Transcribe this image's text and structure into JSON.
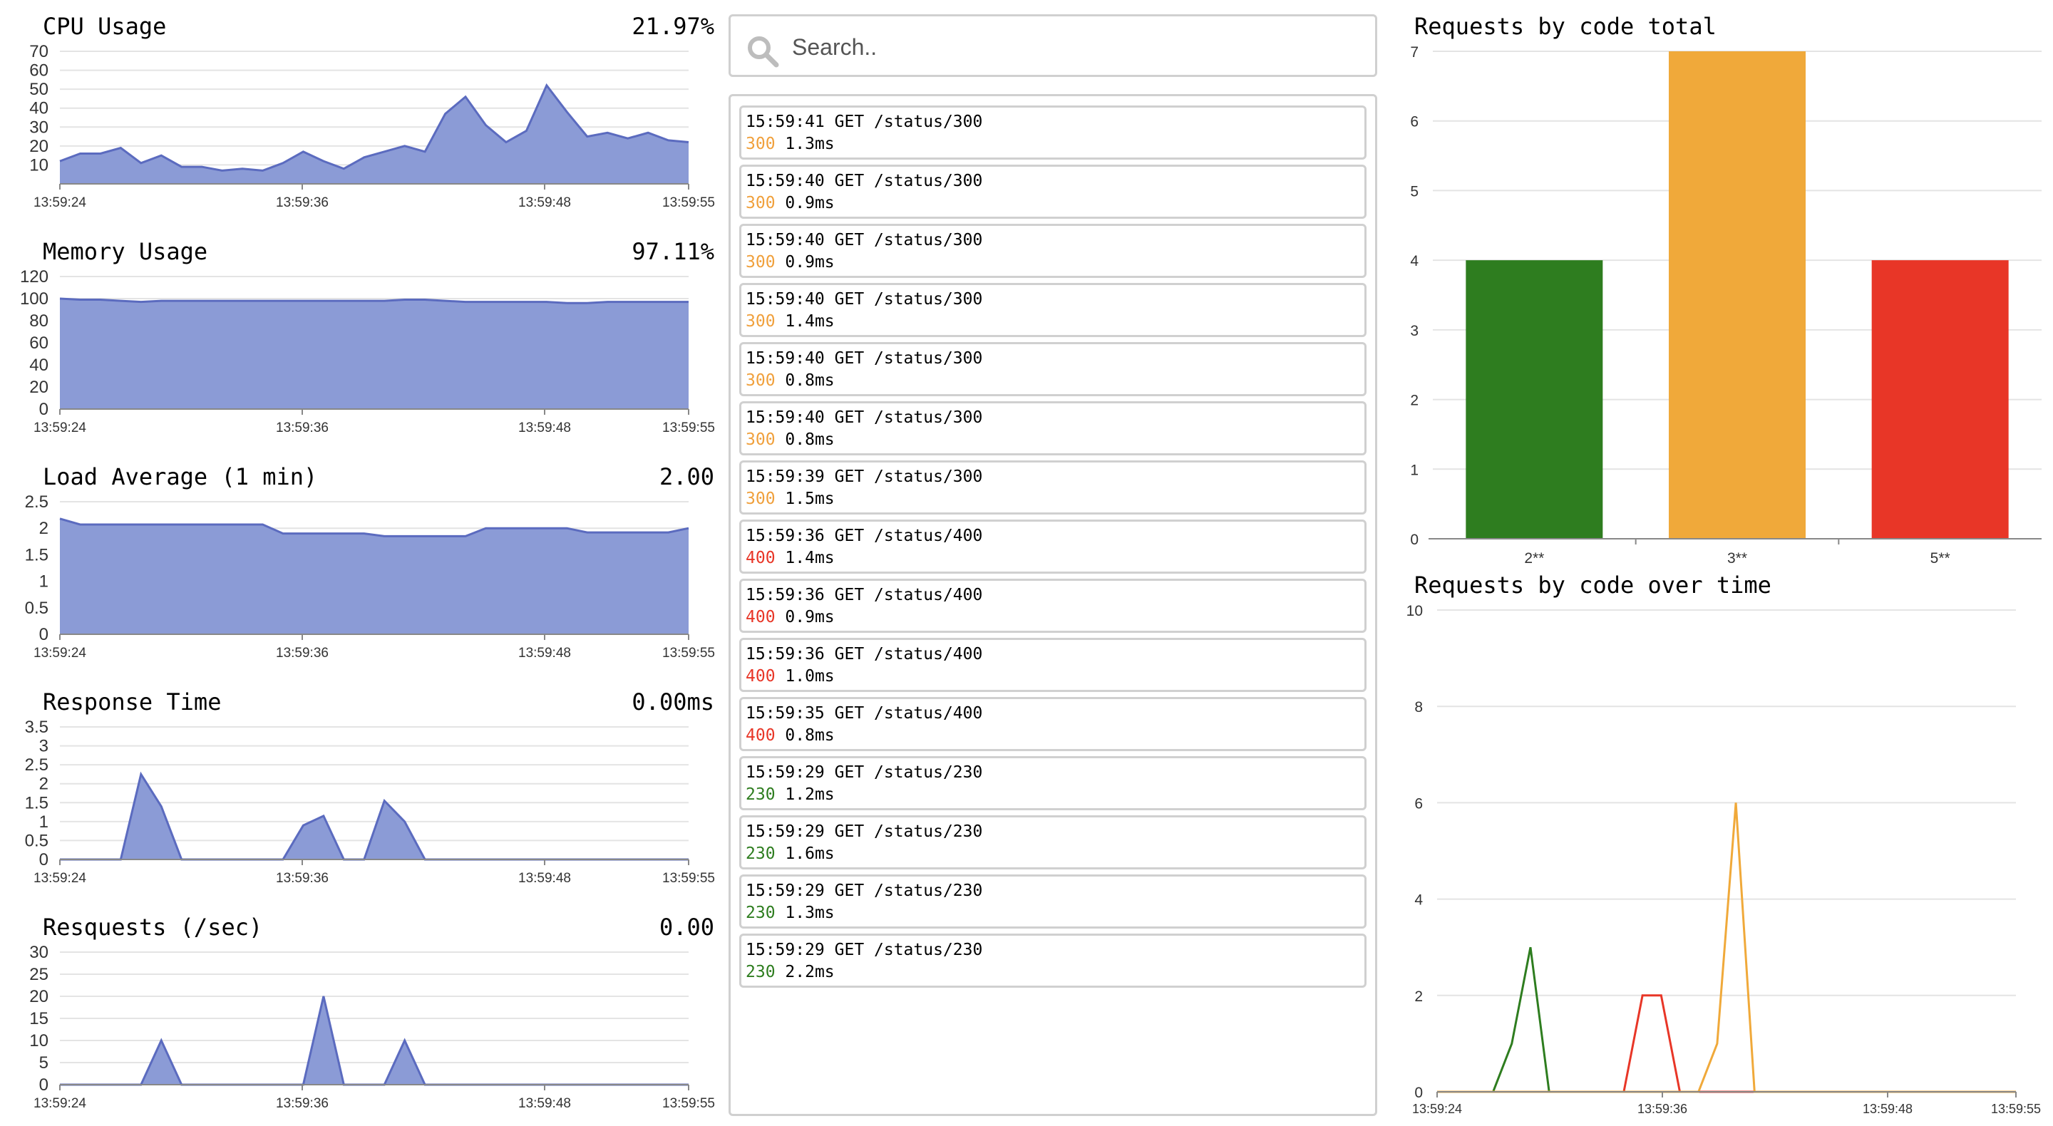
{
  "colors": {
    "area_fill": "#8b9bd6",
    "area_line": "#5b6bbf",
    "grid": "#e4e4e4",
    "axis": "#888888",
    "green": "#2e7d1f",
    "orange": "#f0a93a",
    "red": "#e83627"
  },
  "panels": [
    {
      "title": "CPU Usage",
      "value": "21.97%",
      "chart_data": {
        "type": "area",
        "x_ticks": [
          "13:59:24",
          "13:59:36",
          "13:59:48",
          "13:59:55"
        ],
        "y_ticks": [
          "70",
          "60",
          "50",
          "40",
          "30",
          "20",
          "10"
        ],
        "ylim": [
          0,
          70
        ],
        "y_tick_values": [
          70,
          60,
          50,
          40,
          30,
          20,
          10
        ],
        "values": [
          12,
          16,
          16,
          19,
          11,
          15,
          9,
          9,
          7,
          8,
          7,
          11,
          17,
          12,
          8,
          14,
          17,
          20,
          17,
          37,
          46,
          31,
          22,
          28,
          52,
          38,
          25,
          27,
          24,
          27,
          23,
          22
        ]
      }
    },
    {
      "title": "Memory Usage",
      "value": "97.11%",
      "chart_data": {
        "type": "area",
        "x_ticks": [
          "13:59:24",
          "13:59:36",
          "13:59:48",
          "13:59:55"
        ],
        "y_ticks": [
          "120",
          "100",
          "80",
          "60",
          "40",
          "20",
          "0"
        ],
        "ylim": [
          0,
          120
        ],
        "y_tick_values": [
          120,
          100,
          80,
          60,
          40,
          20,
          0
        ],
        "values": [
          100,
          99,
          99,
          98,
          97,
          98,
          98,
          98,
          98,
          98,
          98,
          98,
          98,
          98,
          98,
          98,
          98,
          99,
          99,
          98,
          97,
          97,
          97,
          97,
          97,
          96,
          96,
          97,
          97,
          97,
          97,
          97
        ]
      }
    },
    {
      "title": "Load Average (1 min)",
      "value": "2.00",
      "chart_data": {
        "type": "area",
        "x_ticks": [
          "13:59:24",
          "13:59:36",
          "13:59:48",
          "13:59:55"
        ],
        "y_ticks": [
          "2.5",
          "2",
          "1.5",
          "1",
          "0.5",
          "0"
        ],
        "ylim": [
          0,
          2.5
        ],
        "y_tick_values": [
          2.5,
          2,
          1.5,
          1,
          0.5,
          0
        ],
        "values": [
          2.18,
          2.07,
          2.07,
          2.07,
          2.07,
          2.07,
          2.07,
          2.07,
          2.07,
          2.07,
          2.07,
          1.9,
          1.9,
          1.9,
          1.9,
          1.9,
          1.85,
          1.85,
          1.85,
          1.85,
          1.85,
          2.0,
          2.0,
          2.0,
          2.0,
          2.0,
          1.92,
          1.92,
          1.92,
          1.92,
          1.92,
          2.0
        ]
      }
    },
    {
      "title": "Response Time",
      "value": "0.00ms",
      "chart_data": {
        "type": "area",
        "x_ticks": [
          "13:59:24",
          "13:59:36",
          "13:59:48",
          "13:59:55"
        ],
        "y_ticks": [
          "3.5",
          "3",
          "2.5",
          "2",
          "1.5",
          "1",
          "0.5",
          "0"
        ],
        "ylim": [
          0,
          3.5
        ],
        "y_tick_values": [
          3.5,
          3,
          2.5,
          2,
          1.5,
          1,
          0.5,
          0
        ],
        "values": [
          0,
          0,
          0,
          0,
          2.25,
          1.4,
          0,
          0,
          0,
          0,
          0,
          0,
          0.9,
          1.15,
          0,
          0,
          1.55,
          1.0,
          0,
          0,
          0,
          0,
          0,
          0,
          0,
          0,
          0,
          0,
          0,
          0,
          0,
          0
        ]
      }
    },
    {
      "title": "Resquests (/sec)",
      "value": "0.00",
      "chart_data": {
        "type": "area",
        "x_ticks": [
          "13:59:24",
          "13:59:36",
          "13:59:48",
          "13:59:55"
        ],
        "y_ticks": [
          "30",
          "25",
          "20",
          "15",
          "10",
          "5",
          "0"
        ],
        "ylim": [
          0,
          30
        ],
        "y_tick_values": [
          30,
          25,
          20,
          15,
          10,
          5,
          0
        ],
        "values": [
          0,
          0,
          0,
          0,
          0,
          10,
          0,
          0,
          0,
          0,
          0,
          0,
          0,
          20,
          0,
          0,
          0,
          10,
          0,
          0,
          0,
          0,
          0,
          0,
          0,
          0,
          0,
          0,
          0,
          0,
          0,
          0
        ]
      }
    }
  ],
  "search": {
    "placeholder": "Search.."
  },
  "log": [
    {
      "line": "15:59:41 GET /status/300",
      "code": "300",
      "time": "1.3ms"
    },
    {
      "line": "15:59:40 GET /status/300",
      "code": "300",
      "time": "0.9ms"
    },
    {
      "line": "15:59:40 GET /status/300",
      "code": "300",
      "time": "0.9ms"
    },
    {
      "line": "15:59:40 GET /status/300",
      "code": "300",
      "time": "1.4ms"
    },
    {
      "line": "15:59:40 GET /status/300",
      "code": "300",
      "time": "0.8ms"
    },
    {
      "line": "15:59:40 GET /status/300",
      "code": "300",
      "time": "0.8ms"
    },
    {
      "line": "15:59:39 GET /status/300",
      "code": "300",
      "time": "1.5ms"
    },
    {
      "line": "15:59:36 GET /status/400",
      "code": "400",
      "time": "1.4ms"
    },
    {
      "line": "15:59:36 GET /status/400",
      "code": "400",
      "time": "0.9ms"
    },
    {
      "line": "15:59:36 GET /status/400",
      "code": "400",
      "time": "1.0ms"
    },
    {
      "line": "15:59:35 GET /status/400",
      "code": "400",
      "time": "0.8ms"
    },
    {
      "line": "15:59:29 GET /status/230",
      "code": "230",
      "time": "1.2ms"
    },
    {
      "line": "15:59:29 GET /status/230",
      "code": "230",
      "time": "1.6ms"
    },
    {
      "line": "15:59:29 GET /status/230",
      "code": "230",
      "time": "1.3ms"
    },
    {
      "line": "15:59:29 GET /status/230",
      "code": "230",
      "time": "2.2ms"
    }
  ],
  "bar_title": "Requests by code total",
  "line_title": "Requests by code over time",
  "chart_data": [
    {
      "type": "bar",
      "categories": [
        "2**",
        "3**",
        "5**"
      ],
      "values": [
        4,
        7,
        4
      ],
      "colors": [
        "#2e7d1f",
        "#f0a93a",
        "#e83627"
      ],
      "ylim": [
        0,
        7
      ],
      "y_ticks": [
        "7",
        "6",
        "5",
        "4",
        "3",
        "2",
        "1",
        "0"
      ],
      "y_tick_values": [
        7,
        6,
        5,
        4,
        3,
        2,
        1,
        0
      ]
    },
    {
      "type": "line",
      "x_ticks": [
        "13:59:24",
        "13:59:36",
        "13:59:48",
        "13:59:55"
      ],
      "ylim": [
        0,
        10
      ],
      "y_ticks": [
        "10",
        "8",
        "6",
        "4",
        "2",
        "0"
      ],
      "y_tick_values": [
        10,
        8,
        6,
        4,
        2,
        0
      ],
      "series": [
        {
          "color": "#2e7d1f",
          "values": [
            0,
            0,
            0,
            0,
            1,
            3,
            0,
            0,
            0,
            0,
            0,
            0,
            0,
            0,
            0,
            0,
            0,
            0,
            0,
            0,
            0,
            0,
            0,
            0,
            0,
            0,
            0,
            0,
            0,
            0,
            0,
            0
          ]
        },
        {
          "color": "#e83627",
          "values": [
            0,
            0,
            0,
            0,
            0,
            0,
            0,
            0,
            0,
            0,
            0,
            2,
            2,
            0,
            0,
            0,
            0,
            0,
            0,
            0,
            0,
            0,
            0,
            0,
            0,
            0,
            0,
            0,
            0,
            0,
            0,
            0
          ]
        },
        {
          "color": "#f0a93a",
          "values": [
            0,
            0,
            0,
            0,
            0,
            0,
            0,
            0,
            0,
            0,
            0,
            0,
            0,
            0,
            0,
            1,
            6,
            0,
            0,
            0,
            0,
            0,
            0,
            0,
            0,
            0,
            0,
            0,
            0,
            0,
            0,
            0
          ]
        }
      ]
    }
  ]
}
